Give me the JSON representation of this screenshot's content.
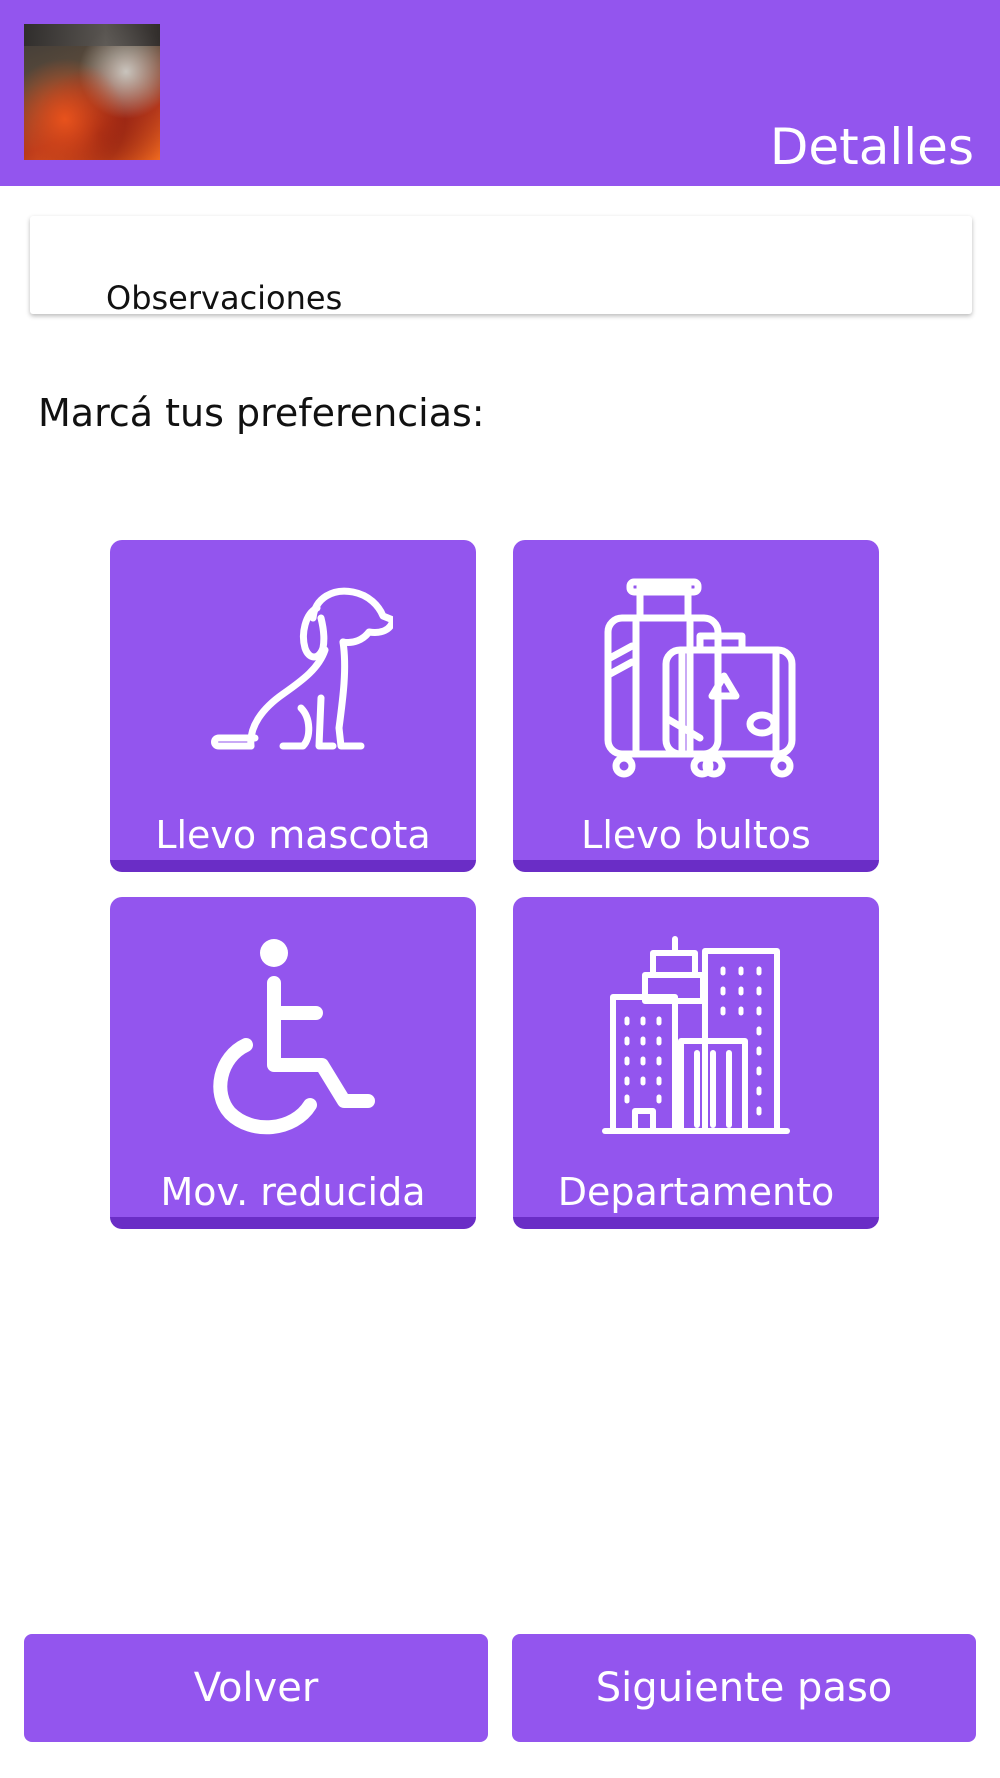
{
  "header": {
    "title": "Detalles",
    "logo_icon": "album-cover-image"
  },
  "observations": {
    "label": "Observaciones"
  },
  "preferences": {
    "title": "Marcá tus preferencias:",
    "options": [
      {
        "label": "Llevo mascota",
        "icon": "dog-icon"
      },
      {
        "label": "Llevo bultos",
        "icon": "luggage-icon"
      },
      {
        "label": "Mov. reducida",
        "icon": "wheelchair-icon"
      },
      {
        "label": "Departamento",
        "icon": "buildings-icon"
      }
    ]
  },
  "footer": {
    "back_label": "Volver",
    "next_label": "Siguiente paso"
  },
  "colors": {
    "primary": "#9355ee",
    "primary_dark": "#6a2dc6",
    "text": "#111111",
    "background": "#ffffff"
  }
}
